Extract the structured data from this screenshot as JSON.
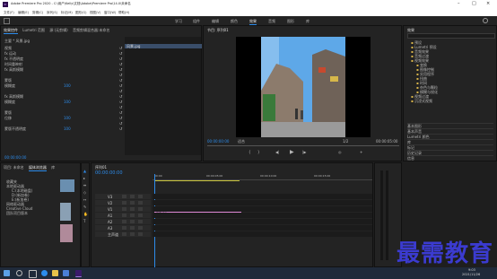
{
  "window": {
    "title": "Adobe Premiere Pro 2020 - C:\\用户\\Kelly\\文档\\Adobe\\Premiere Pro\\14.0\\未命名"
  },
  "menu": [
    "文件(F)",
    "编辑(E)",
    "剪辑(C)",
    "序列(S)",
    "标记(M)",
    "图形(G)",
    "视图(V)",
    "窗口(W)",
    "帮助(H)"
  ],
  "workspaces": [
    "学习",
    "组件",
    "编辑",
    "颜色",
    "效果",
    "音频",
    "图形",
    "库"
  ],
  "effect_controls": {
    "tabs": [
      "效果控件",
      "Lumetri 范围",
      "源:(无剪辑)",
      "音频剪辑混合器:未命名"
    ],
    "header": "主要 * 风景.jpg",
    "clip": "风景.jpg",
    "rows": [
      "视频",
      "fx 运动",
      "fx 不透明度",
      "时间重映射",
      "fx 高斯模糊",
      "",
      "蒙版",
      "模糊度",
      "",
      "fx 高斯模糊",
      "模糊度",
      "",
      "蒙版",
      "位移",
      "",
      "蒙版不透明度"
    ],
    "values": [
      "",
      "",
      "",
      "",
      "",
      "",
      "",
      "100",
      "",
      "",
      "100",
      "",
      "",
      "100",
      "",
      "100"
    ],
    "timecode": "00:00:00:00"
  },
  "program": {
    "title": "节目: 序列01",
    "timecode": "00:00:00:00",
    "fit": "适合",
    "ratio": "1/2",
    "duration": "00:00:05:00"
  },
  "effects_panel": {
    "title": "效果",
    "tree": [
      "预设",
      "Lumetri 预设",
      "音频效果",
      "音频过渡",
      "视频效果",
      "变换",
      "图像控制",
      "实用程序",
      "扭曲",
      "时间",
      "杂色与颗粒",
      "模糊与锐化",
      "视频过渡",
      "沉浸式视频"
    ],
    "sections": [
      "基本图形",
      "基本声音",
      "Lumetri 颜色",
      "库",
      "标记",
      "历史记录",
      "信息"
    ]
  },
  "project": {
    "tabs": [
      "项目: 未命名",
      "媒体浏览器",
      "库"
    ],
    "items": [
      "收藏夹",
      "本地驱动器",
      "C:(本地磁盘)",
      "D:(新加卷)",
      "E:(新加卷)",
      "网络驱动器",
      "Creative Cloud",
      "团队项目版本"
    ]
  },
  "timeline": {
    "title": "序列01",
    "timecode": "00:00:00:00",
    "ruler": [
      "00:00",
      "00:00:05:00",
      "00:00:10:00",
      "00:00:15:00"
    ],
    "tracks": [
      "V3",
      "V2",
      "V1",
      "A1",
      "A2",
      "A3",
      "主声道"
    ],
    "clip_label": "风景.jpg"
  },
  "watermark": "最需教育",
  "taskbar": {
    "time": "9:03",
    "date": "2021/11/26"
  }
}
